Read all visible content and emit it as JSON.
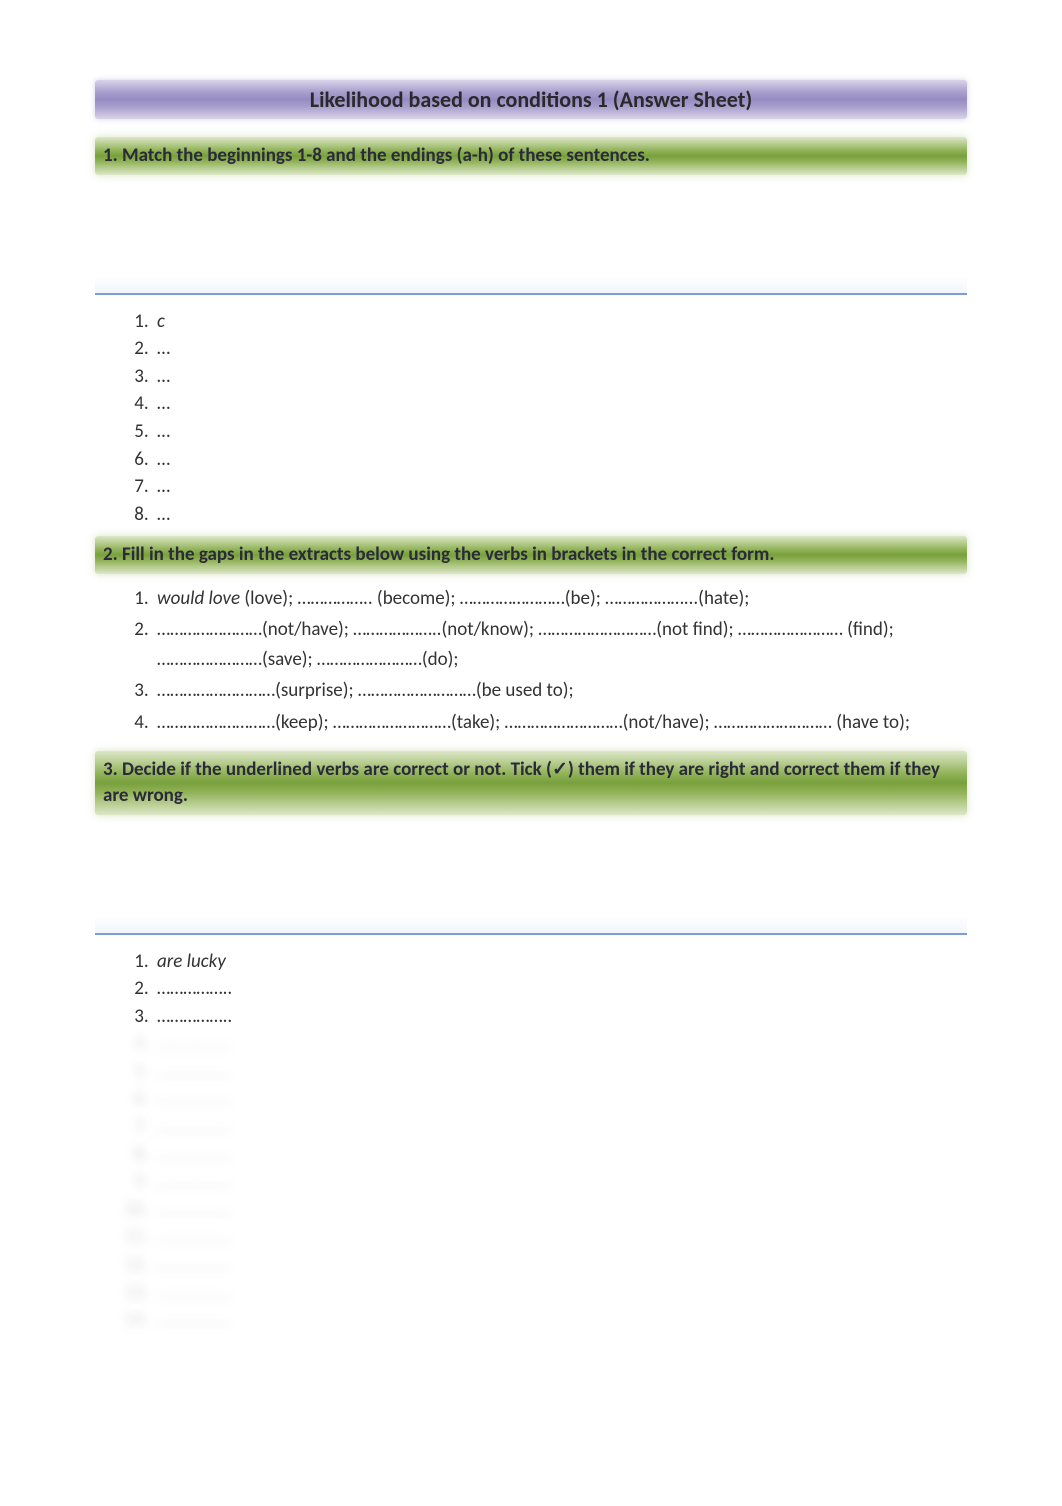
{
  "title": "Likelihood based on conditions 1 (Answer Sheet)",
  "section1": {
    "heading": "1. Match the beginnings 1-8 and the endings (a-h) of these sentences.",
    "answers": [
      "c",
      "…",
      "…",
      "…",
      "…",
      "…",
      "…",
      "…"
    ]
  },
  "section2": {
    "heading": "2. Fill in the gaps in the extracts below using the verbs in brackets in the correct form.",
    "items": [
      {
        "lead": "would love",
        "rest": " (love); …………….. (become); ……………………(be); ………………...(hate);"
      },
      {
        "lead": "",
        "rest": "……………………(not/have); ………………..(not/know); ………………………(not find); …………………… (find); ……………………(save); ……………………(do);"
      },
      {
        "lead": "",
        "rest": "………………………(surprise); ………………………(be used to);"
      },
      {
        "lead": "",
        "rest": "………………………(keep); ………………………(take); ………………………(not/have); ……………………… (have to);"
      }
    ]
  },
  "section3": {
    "heading": "3. Decide if the underlined verbs are correct or not. Tick (✓) them if they are right and correct them if they are wrong.",
    "answers": [
      "are lucky",
      "……………..",
      "……………..",
      "……………..",
      "……………..",
      "……………..",
      "……………..",
      "……………..",
      "……………..",
      "……………..",
      "……………..",
      "……………..",
      "……………..",
      "…………….."
    ]
  }
}
